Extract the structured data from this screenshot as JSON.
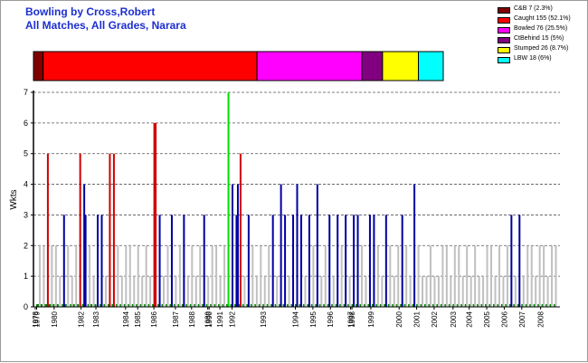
{
  "titles": {
    "line1": "Bowling by Cross,Robert",
    "line2": "All Matches, All Grades, Narara"
  },
  "chart_data": [
    {
      "type": "bar",
      "subtype": "stacked-100-percent",
      "title": "",
      "series": [
        {
          "name": "C&B",
          "value": 7,
          "percent": 2.3,
          "label": "C&B 7 (2.3%)",
          "color": "#800000"
        },
        {
          "name": "Caught",
          "value": 155,
          "percent": 52.1,
          "label": "Caught 155 (52.1%)",
          "color": "#ff0000"
        },
        {
          "name": "Bowled",
          "value": 76,
          "percent": 25.5,
          "label": "Bowled 76 (25.5%)",
          "color": "#ff00ff"
        },
        {
          "name": "CtBehind",
          "value": 15,
          "percent": 5,
          "label": "CtBehind 15 (5%)",
          "color": "#800080"
        },
        {
          "name": "Stumped",
          "value": 26,
          "percent": 8.7,
          "label": "Stumped 26 (8.7%)",
          "color": "#ffff00"
        },
        {
          "name": "LBW",
          "value": 18,
          "percent": 6,
          "label": "LBW 18 (6%)",
          "color": "#00ffff"
        }
      ],
      "legend": "top-right"
    },
    {
      "type": "bar",
      "title": "",
      "ylabel": "Wkts",
      "xlabel": "",
      "ylim": [
        0,
        7
      ],
      "yticks": [
        0,
        1,
        2,
        3,
        4,
        5,
        6,
        7
      ],
      "grid": "horizontal dashed",
      "x_axis_labels": [
        {
          "label": "1978",
          "index": 0
        },
        {
          "label": "1979",
          "index": 1
        },
        {
          "label": "1980",
          "index": 14
        },
        {
          "label": "1982",
          "index": 34
        },
        {
          "label": "1983",
          "index": 45
        },
        {
          "label": "1984",
          "index": 67
        },
        {
          "label": "1985",
          "index": 76
        },
        {
          "label": "1986",
          "index": 88
        },
        {
          "label": "1987",
          "index": 104
        },
        {
          "label": "1988",
          "index": 116
        },
        {
          "label": "1989",
          "index": 128
        },
        {
          "label": "1990",
          "index": 129
        },
        {
          "label": "1991",
          "index": 137
        },
        {
          "label": "1992",
          "index": 146
        },
        {
          "label": "1993",
          "index": 169
        },
        {
          "label": "1994",
          "index": 193
        },
        {
          "label": "1995",
          "index": 206
        },
        {
          "label": "1996",
          "index": 219
        },
        {
          "label": "1997",
          "index": 234
        },
        {
          "label": "1998",
          "index": 235
        },
        {
          "label": "1999",
          "index": 249
        },
        {
          "label": "2000",
          "index": 270
        },
        {
          "label": "2001",
          "index": 283
        },
        {
          "label": "2002",
          "index": 296
        },
        {
          "label": "2003",
          "index": 310
        },
        {
          "label": "2004",
          "index": 322
        },
        {
          "label": "2005",
          "index": 335
        },
        {
          "label": "2006",
          "index": 348
        },
        {
          "label": "2007",
          "index": 361
        },
        {
          "label": "2008",
          "index": 375
        }
      ],
      "bars_index_count": 388,
      "colors": {
        "zero": "#008000",
        "one_two": "#c0c0c0",
        "three_four": "#0000a0",
        "five_six": "#d00000",
        "seven": "#00e000"
      },
      "bars": [
        {
          "i": 3,
          "v": 2
        },
        {
          "i": 6,
          "v": 2
        },
        {
          "i": 9,
          "v": 5
        },
        {
          "i": 12,
          "v": 2
        },
        {
          "i": 15,
          "v": 2
        },
        {
          "i": 18,
          "v": 1
        },
        {
          "i": 21,
          "v": 3
        },
        {
          "i": 24,
          "v": 2
        },
        {
          "i": 27,
          "v": 1
        },
        {
          "i": 30,
          "v": 2
        },
        {
          "i": 33,
          "v": 5
        },
        {
          "i": 36,
          "v": 4
        },
        {
          "i": 37,
          "v": 3
        },
        {
          "i": 40,
          "v": 2
        },
        {
          "i": 43,
          "v": 1
        },
        {
          "i": 46,
          "v": 3
        },
        {
          "i": 49,
          "v": 3
        },
        {
          "i": 52,
          "v": 1
        },
        {
          "i": 55,
          "v": 5
        },
        {
          "i": 58,
          "v": 5
        },
        {
          "i": 61,
          "v": 2
        },
        {
          "i": 64,
          "v": 1
        },
        {
          "i": 67,
          "v": 2
        },
        {
          "i": 70,
          "v": 2
        },
        {
          "i": 73,
          "v": 1
        },
        {
          "i": 76,
          "v": 2
        },
        {
          "i": 79,
          "v": 1
        },
        {
          "i": 82,
          "v": 2
        },
        {
          "i": 85,
          "v": 1
        },
        {
          "i": 88,
          "v": 6
        },
        {
          "i": 89,
          "v": 6
        },
        {
          "i": 92,
          "v": 3
        },
        {
          "i": 95,
          "v": 1
        },
        {
          "i": 98,
          "v": 2
        },
        {
          "i": 101,
          "v": 3
        },
        {
          "i": 104,
          "v": 1
        },
        {
          "i": 107,
          "v": 2
        },
        {
          "i": 110,
          "v": 3
        },
        {
          "i": 113,
          "v": 1
        },
        {
          "i": 116,
          "v": 2
        },
        {
          "i": 119,
          "v": 1
        },
        {
          "i": 122,
          "v": 2
        },
        {
          "i": 125,
          "v": 3
        },
        {
          "i": 128,
          "v": 1
        },
        {
          "i": 131,
          "v": 2
        },
        {
          "i": 134,
          "v": 2
        },
        {
          "i": 137,
          "v": 1
        },
        {
          "i": 140,
          "v": 2
        },
        {
          "i": 143,
          "v": 7
        },
        {
          "i": 146,
          "v": 4
        },
        {
          "i": 149,
          "v": 3
        },
        {
          "i": 150,
          "v": 4
        },
        {
          "i": 152,
          "v": 5
        },
        {
          "i": 155,
          "v": 1
        },
        {
          "i": 158,
          "v": 3
        },
        {
          "i": 161,
          "v": 2
        },
        {
          "i": 164,
          "v": 1
        },
        {
          "i": 167,
          "v": 2
        },
        {
          "i": 170,
          "v": 1
        },
        {
          "i": 173,
          "v": 2
        },
        {
          "i": 176,
          "v": 3
        },
        {
          "i": 179,
          "v": 1
        },
        {
          "i": 182,
          "v": 4
        },
        {
          "i": 185,
          "v": 3
        },
        {
          "i": 188,
          "v": 1
        },
        {
          "i": 191,
          "v": 3
        },
        {
          "i": 194,
          "v": 4
        },
        {
          "i": 197,
          "v": 3
        },
        {
          "i": 200,
          "v": 1
        },
        {
          "i": 203,
          "v": 3
        },
        {
          "i": 206,
          "v": 2
        },
        {
          "i": 209,
          "v": 4
        },
        {
          "i": 212,
          "v": 1
        },
        {
          "i": 215,
          "v": 2
        },
        {
          "i": 218,
          "v": 3
        },
        {
          "i": 221,
          "v": 1
        },
        {
          "i": 224,
          "v": 3
        },
        {
          "i": 227,
          "v": 2
        },
        {
          "i": 230,
          "v": 3
        },
        {
          "i": 233,
          "v": 1
        },
        {
          "i": 236,
          "v": 3
        },
        {
          "i": 239,
          "v": 3
        },
        {
          "i": 242,
          "v": 2
        },
        {
          "i": 245,
          "v": 1
        },
        {
          "i": 248,
          "v": 3
        },
        {
          "i": 251,
          "v": 3
        },
        {
          "i": 254,
          "v": 2
        },
        {
          "i": 257,
          "v": 1
        },
        {
          "i": 260,
          "v": 3
        },
        {
          "i": 263,
          "v": 2
        },
        {
          "i": 266,
          "v": 1
        },
        {
          "i": 269,
          "v": 2
        },
        {
          "i": 272,
          "v": 3
        },
        {
          "i": 275,
          "v": 2
        },
        {
          "i": 278,
          "v": 1
        },
        {
          "i": 281,
          "v": 4
        },
        {
          "i": 284,
          "v": 2
        },
        {
          "i": 287,
          "v": 1
        },
        {
          "i": 290,
          "v": 1
        },
        {
          "i": 293,
          "v": 2
        },
        {
          "i": 296,
          "v": 1
        },
        {
          "i": 299,
          "v": 1
        },
        {
          "i": 302,
          "v": 2
        },
        {
          "i": 305,
          "v": 2
        },
        {
          "i": 308,
          "v": 1
        },
        {
          "i": 311,
          "v": 2
        },
        {
          "i": 314,
          "v": 2
        },
        {
          "i": 317,
          "v": 1
        },
        {
          "i": 320,
          "v": 2
        },
        {
          "i": 323,
          "v": 1
        },
        {
          "i": 326,
          "v": 2
        },
        {
          "i": 329,
          "v": 1
        },
        {
          "i": 332,
          "v": 1
        },
        {
          "i": 335,
          "v": 2
        },
        {
          "i": 338,
          "v": 2
        },
        {
          "i": 341,
          "v": 1
        },
        {
          "i": 344,
          "v": 2
        },
        {
          "i": 347,
          "v": 1
        },
        {
          "i": 350,
          "v": 2
        },
        {
          "i": 353,
          "v": 3
        },
        {
          "i": 356,
          "v": 1
        },
        {
          "i": 359,
          "v": 3
        },
        {
          "i": 362,
          "v": 1
        },
        {
          "i": 365,
          "v": 2
        },
        {
          "i": 368,
          "v": 2
        },
        {
          "i": 371,
          "v": 1
        },
        {
          "i": 374,
          "v": 2
        },
        {
          "i": 377,
          "v": 2
        },
        {
          "i": 380,
          "v": 1
        },
        {
          "i": 383,
          "v": 2
        },
        {
          "i": 386,
          "v": 2
        }
      ],
      "zero_bars": [
        1,
        2,
        4,
        7,
        8,
        10,
        11,
        13,
        16,
        20,
        22,
        26,
        28,
        31,
        35,
        39,
        41,
        44,
        48,
        51,
        54,
        57,
        60,
        63,
        66,
        69,
        72,
        75,
        78,
        81,
        84,
        87,
        91,
        94,
        97,
        100,
        103,
        106,
        109,
        112,
        115,
        118,
        121,
        124,
        127,
        130,
        133,
        136,
        139,
        142,
        145,
        148,
        151,
        154,
        157,
        160,
        163,
        166,
        169,
        172,
        175,
        178,
        181,
        184,
        187,
        190,
        193,
        196,
        199,
        202,
        205,
        208,
        211,
        214,
        217,
        220,
        223,
        226,
        229,
        232,
        235,
        238,
        241,
        244,
        247,
        250,
        253,
        256,
        259,
        262,
        265,
        268,
        271,
        274,
        277,
        280,
        283,
        286,
        289,
        292,
        295,
        298,
        301,
        304,
        307,
        310,
        313,
        316,
        319,
        322,
        325,
        328,
        331,
        334,
        337,
        340,
        343,
        346,
        349,
        352,
        355,
        358,
        361,
        364,
        367,
        370,
        373,
        376,
        379,
        382,
        385
      ]
    }
  ]
}
